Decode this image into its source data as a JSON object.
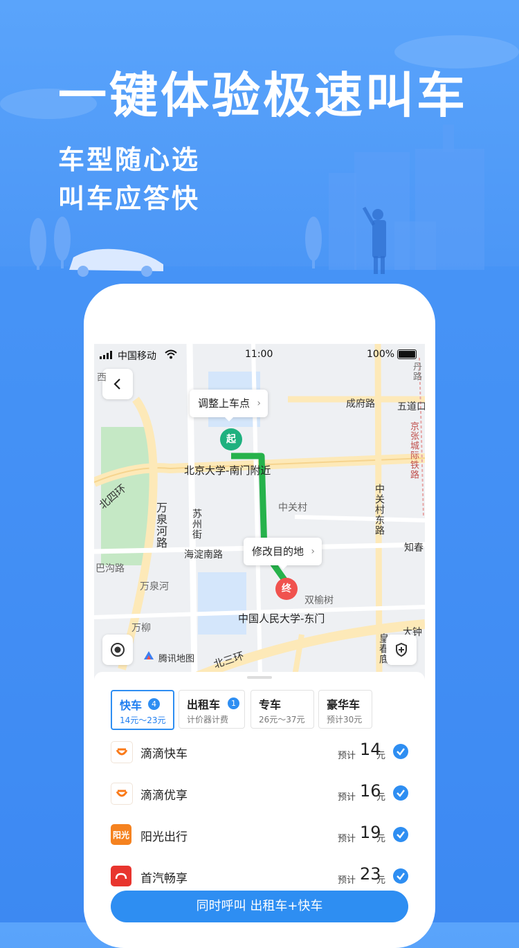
{
  "promo": {
    "headline": "一键体验极速叫车",
    "line1": "车型随心选",
    "line2": "叫车应答快"
  },
  "status_bar": {
    "carrier": "中国移动",
    "time": "11:00",
    "battery": "100%"
  },
  "map": {
    "pickup_bubble": "调整上车点",
    "dest_bubble": "修改目的地",
    "start_pin": "起",
    "end_pin": "终",
    "start_label": "北京大学-南门附近",
    "end_label": "中国人民大学-东门",
    "map_brand": "腾讯地图",
    "labels": {
      "chengfu_road": "成府路",
      "wudaokou": "五道口",
      "jingzhang_rail": "京张城际铁路",
      "west": "西",
      "north_fourth_ring": "北四环",
      "wanquanhe_road": "万泉河路",
      "suzhou_street": "苏州街",
      "zhongguancun": "中关村",
      "zhongguancun_east_road": "中关村东路",
      "haidian_south_road": "海淀南路",
      "zhichun": "知春",
      "bagou_road": "巴沟路",
      "wanquanhe": "万泉河",
      "shuangyushu": "双榆树",
      "wanliu": "万柳",
      "dazhong": "大钟",
      "huangzhuang": "皇春底",
      "north_third_ring": "北三环",
      "top_right": "丹路"
    }
  },
  "tabs": [
    {
      "title": "快车",
      "badge": "4",
      "sub": "14元～23元",
      "active": true
    },
    {
      "title": "出租车",
      "badge": "1",
      "sub": "计价器计费",
      "active": false
    },
    {
      "title": "专车",
      "badge": "",
      "sub": "26元～37元",
      "active": false
    },
    {
      "title": "豪华车",
      "badge": "",
      "sub": "预计30元",
      "active": false
    }
  ],
  "options": [
    {
      "name": "滴滴快车",
      "est": "预计",
      "price": "14",
      "unit": "元",
      "checked": true
    },
    {
      "name": "滴滴优享",
      "est": "预计",
      "price": "16",
      "unit": "元",
      "checked": true
    },
    {
      "name": "阳光出行",
      "est": "预计",
      "price": "19",
      "unit": "元",
      "checked": true,
      "logo_text": "阳光"
    },
    {
      "name": "首汽畅享",
      "est": "预计",
      "price": "23",
      "unit": "元",
      "checked": true
    }
  ],
  "cta_label": "同时呼叫 出租车+快车",
  "colors": {
    "accent": "#2e8ef2",
    "route": "#26b24b",
    "start": "#1fb17f",
    "end": "#f0524e",
    "didi": "#fa7a19"
  },
  "icons": [
    "back-icon",
    "chevron-right-icon",
    "locate-icon",
    "shield-icon",
    "check-icon",
    "didi-logo",
    "signal-icon",
    "wifi-icon",
    "battery-icon"
  ]
}
